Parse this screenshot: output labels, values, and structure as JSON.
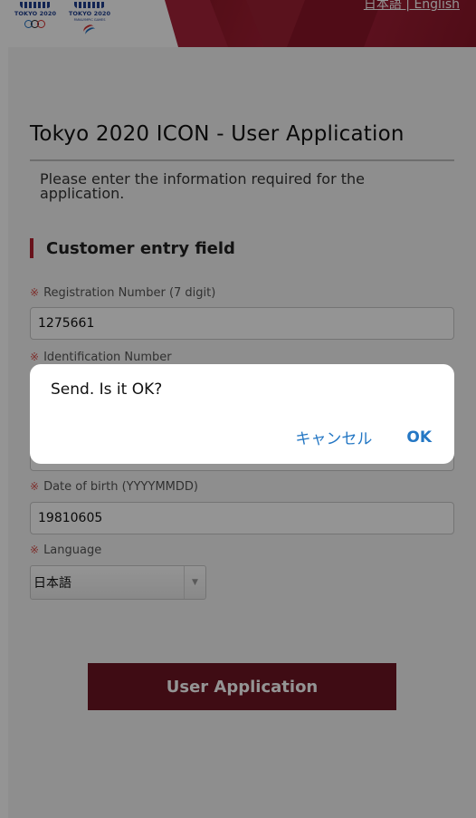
{
  "header": {
    "logos": [
      {
        "text": "TOKYO 2020",
        "kind": "olympic"
      },
      {
        "text": "TOKYO 2020",
        "kind": "paralympic",
        "sub": "PARALYMPIC GAMES"
      }
    ],
    "lang_links": "日本語 | English"
  },
  "page": {
    "title": "Tokyo 2020 ICON - User Application",
    "intro": "Please enter the information required for the application."
  },
  "section": {
    "heading": "Customer entry field"
  },
  "form": {
    "required_mark": "※",
    "registration": {
      "label": "Registration Number (7 digit)",
      "value": "1275661"
    },
    "identification": {
      "label": "Identification Number",
      "value": ""
    },
    "dob": {
      "label": "Date of birth (YYYYMMDD)",
      "value": "19810605"
    },
    "language": {
      "label": "Language",
      "selected": "日本語"
    },
    "submit_label": "User Application"
  },
  "dialog": {
    "message": "Send. Is it OK?",
    "cancel_label": "キャンセル",
    "ok_label": "OK"
  },
  "colors": {
    "brand": "#7c1524",
    "button": "#6d1624",
    "accent": "#b4202f",
    "required": "#d9534f",
    "dialog_link": "#2477c4"
  },
  "icons": {
    "select_arrow": "chevron-down-icon",
    "olympic_rings": "olympic-rings-icon",
    "paralympic_agitos": "paralympic-agitos-icon"
  }
}
